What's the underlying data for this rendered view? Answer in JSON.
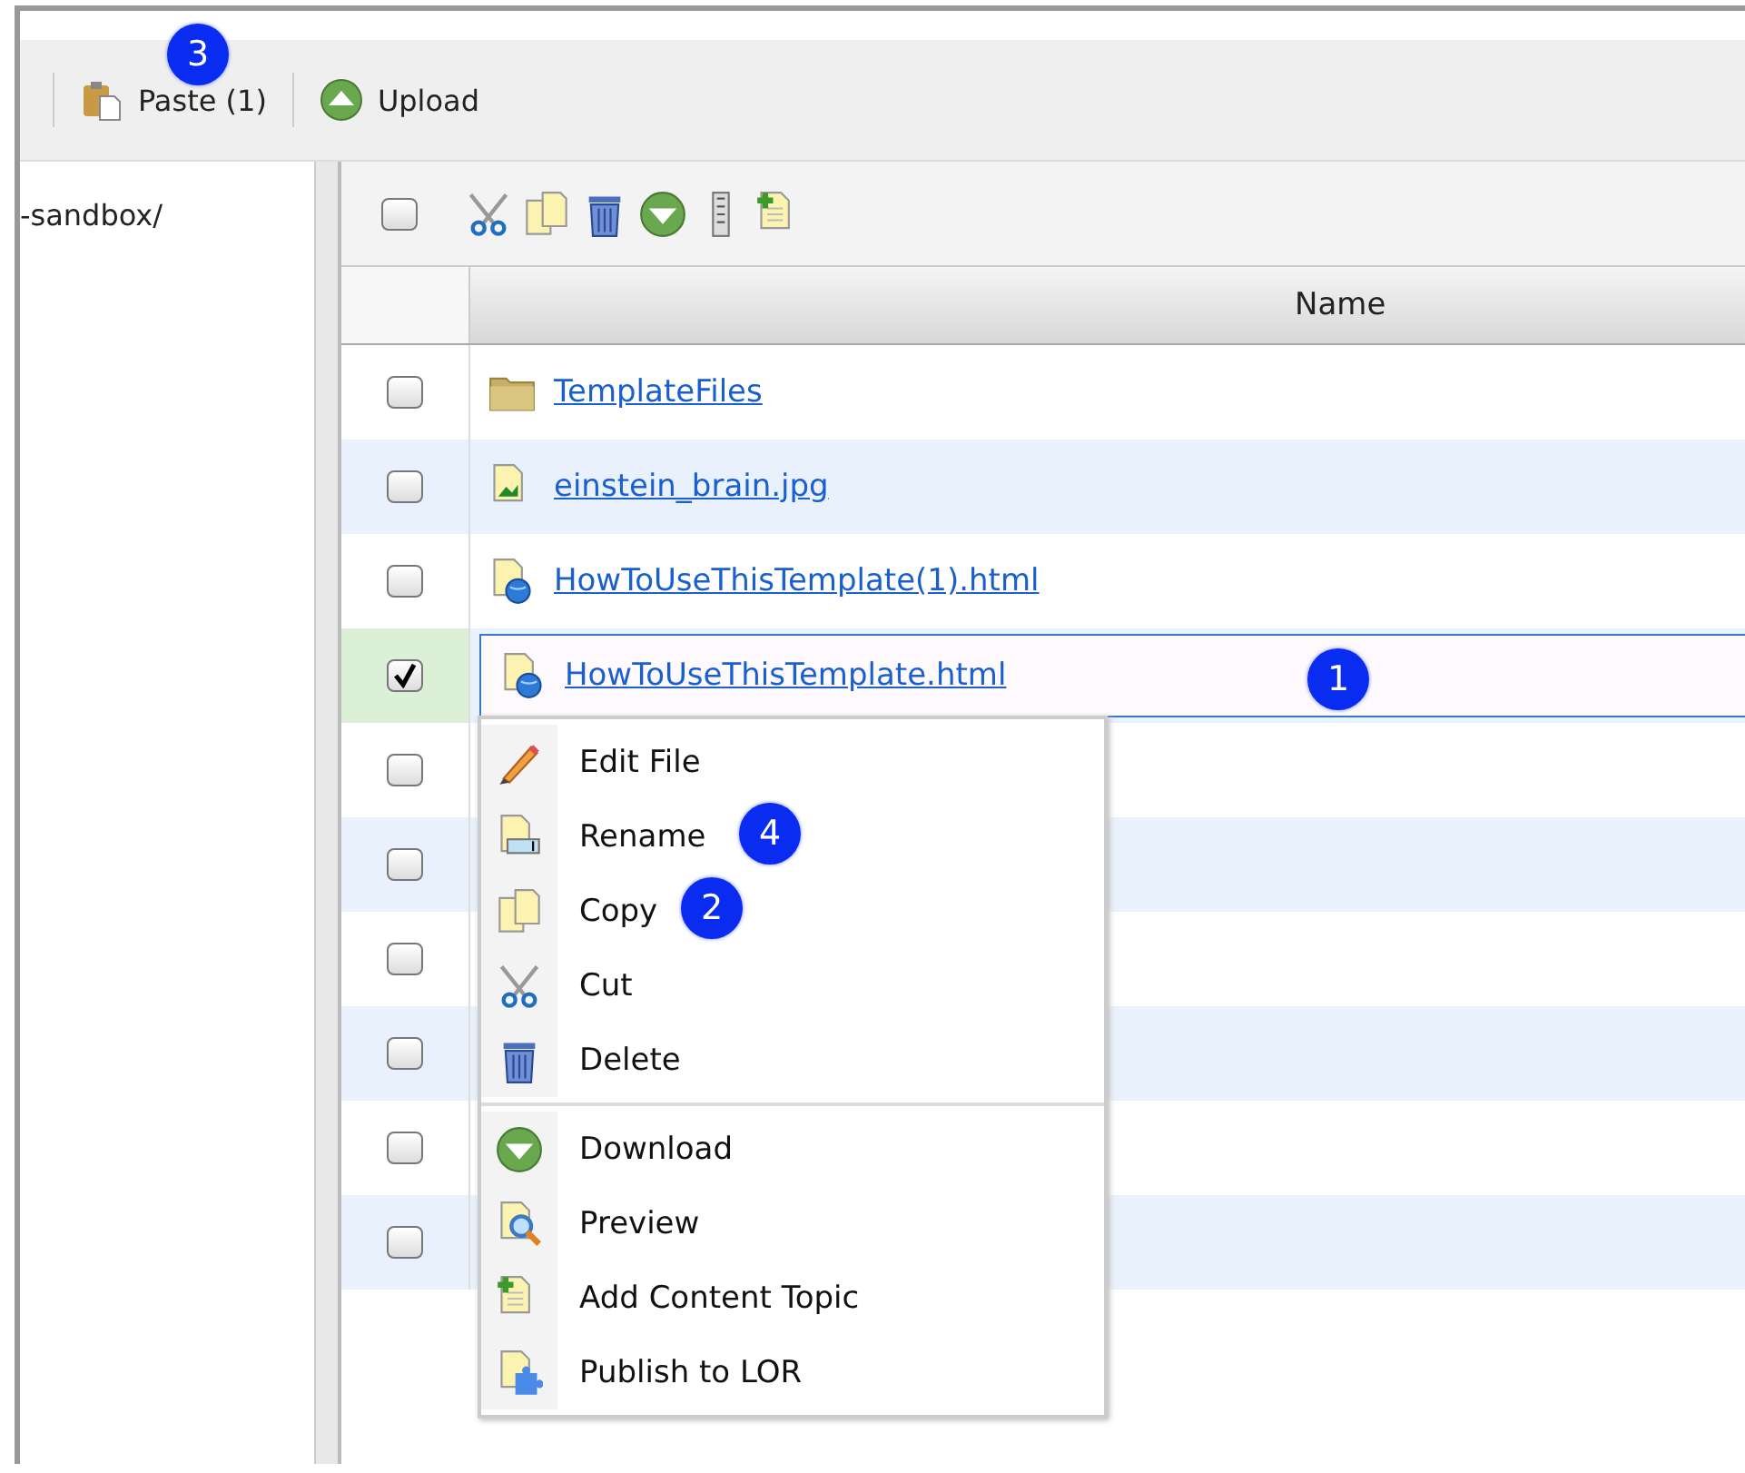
{
  "toolbar": {
    "buttons": [
      {
        "kind": "paste",
        "label": "Paste (1)",
        "callout": "3"
      },
      {
        "kind": "upload",
        "label": "Upload"
      }
    ]
  },
  "sidebar": {
    "path": "-sandbox/"
  },
  "file_toolbar": {
    "select_all": {
      "checked": false
    },
    "actions": [
      {
        "kind": "cut"
      },
      {
        "kind": "copy"
      },
      {
        "kind": "delete"
      },
      {
        "kind": "download"
      },
      {
        "kind": "zip"
      },
      {
        "kind": "add-topic"
      }
    ]
  },
  "table": {
    "columns": [
      "Name"
    ],
    "rows": [
      {
        "kind": "folder",
        "name": "TemplateFiles",
        "checked": false,
        "selected": false
      },
      {
        "kind": "image",
        "name": "einstein_brain.jpg",
        "checked": false,
        "selected": false
      },
      {
        "kind": "html",
        "name": "HowToUseThisTemplate(1).html",
        "checked": false,
        "selected": false
      },
      {
        "kind": "html",
        "name": "HowToUseThisTemplate.html",
        "checked": true,
        "selected": true,
        "callout": "1"
      },
      {
        "checked": false,
        "selected": false
      },
      {
        "checked": false,
        "selected": false
      },
      {
        "checked": false,
        "selected": false
      },
      {
        "checked": false,
        "selected": false
      },
      {
        "checked": false,
        "selected": false
      },
      {
        "checked": false,
        "selected": false
      }
    ]
  },
  "context_menu": {
    "groups": [
      [
        {
          "kind": "edit",
          "label": "Edit File"
        },
        {
          "kind": "rename",
          "label": "Rename",
          "callout": "4"
        },
        {
          "kind": "copy",
          "label": "Copy",
          "callout": "2"
        },
        {
          "kind": "cut",
          "label": "Cut"
        },
        {
          "kind": "delete",
          "label": "Delete"
        }
      ],
      [
        {
          "kind": "download",
          "label": "Download"
        },
        {
          "kind": "preview",
          "label": "Preview"
        },
        {
          "kind": "add-topic",
          "label": "Add Content Topic"
        },
        {
          "kind": "publish",
          "label": "Publish to LOR"
        }
      ]
    ]
  }
}
